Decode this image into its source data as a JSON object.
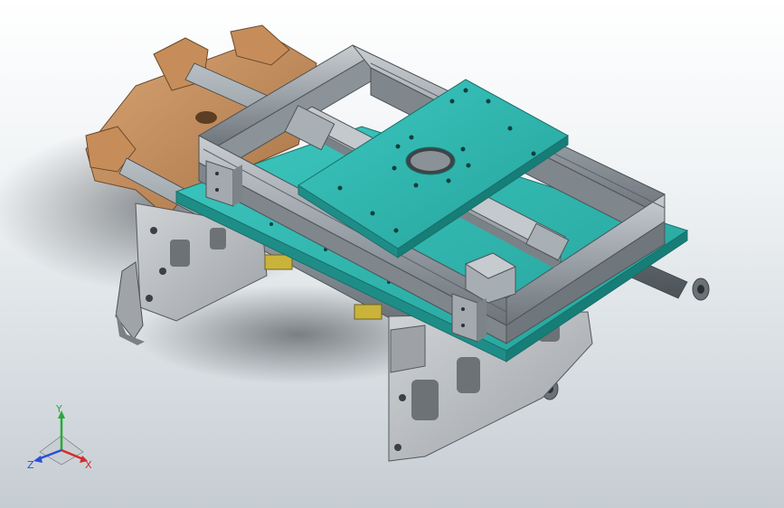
{
  "viewport": {
    "background_top": "#ffffff",
    "background_bottom": "#c6cdd2",
    "colors": {
      "aluminum": "#9aa1a8",
      "plate_teal": "#2fb9b2",
      "bracket_tan": "#c9925f",
      "shaft_grey": "#7d868c",
      "sheet_grey": "#b9bcbf"
    }
  },
  "triad": {
    "x_label": "X",
    "y_label": "Y",
    "z_label": "Z",
    "x_color": "#d42b2b",
    "y_color": "#2ba83a",
    "z_color": "#2b4fd4"
  }
}
